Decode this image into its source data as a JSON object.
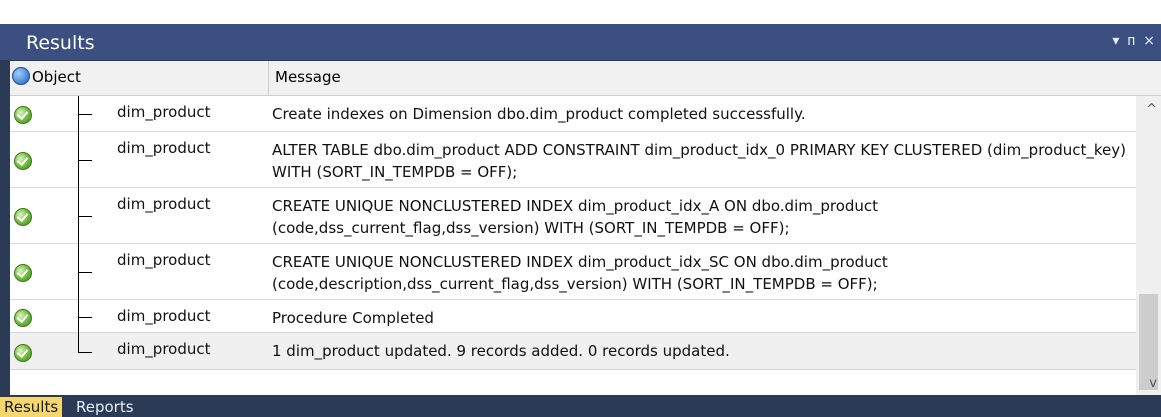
{
  "window": {
    "title": "Results",
    "buttons": [
      "▾",
      "ᴨ",
      "×"
    ]
  },
  "grid": {
    "columns": {
      "object": "Object",
      "message": "Message"
    },
    "rows": [
      {
        "object": "dim_product",
        "message": "Create indexes on Dimension dbo.dim_product completed successfully.",
        "status": "success"
      },
      {
        "object": "dim_product",
        "message": "ALTER TABLE dbo.dim_product ADD CONSTRAINT dim_product_idx_0 PRIMARY KEY CLUSTERED (dim_product_key) WITH (SORT_IN_TEMPDB = OFF);",
        "status": "success"
      },
      {
        "object": "dim_product",
        "message": "CREATE UNIQUE NONCLUSTERED INDEX dim_product_idx_A ON dbo.dim_product (code,dss_current_flag,dss_version) WITH (SORT_IN_TEMPDB = OFF);",
        "status": "success"
      },
      {
        "object": "dim_product",
        "message": "CREATE UNIQUE NONCLUSTERED INDEX dim_product_idx_SC ON dbo.dim_product (code,description,dss_current_flag,dss_version) WITH (SORT_IN_TEMPDB = OFF);",
        "status": "success"
      },
      {
        "object": "dim_product",
        "message": "Procedure Completed",
        "status": "success"
      },
      {
        "object": "dim_product",
        "message": "1  dim_product updated. 9 records added. 0 records updated.",
        "status": "success"
      }
    ]
  },
  "tabs": [
    {
      "label": "Results",
      "active": true
    },
    {
      "label": "Reports",
      "active": false
    }
  ]
}
